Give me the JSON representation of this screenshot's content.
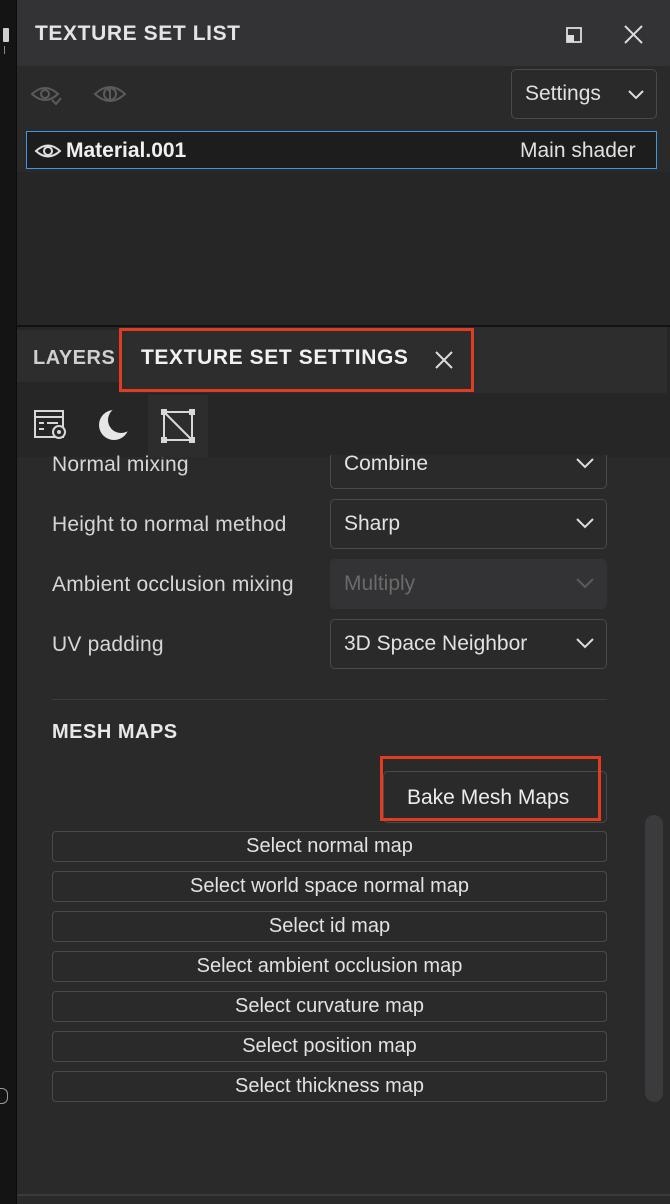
{
  "header": {
    "title": "TEXTURE SET LIST"
  },
  "toolbar": {
    "settings_label": "Settings"
  },
  "texture_set": {
    "name": "Material.001",
    "shader": "Main shader"
  },
  "tabs": {
    "layers": "LAYERS",
    "texture_set_settings": "TEXTURE SET SETTINGS"
  },
  "settings": [
    {
      "label": "Normal mixing",
      "value": "Combine"
    },
    {
      "label": "Height to normal method",
      "value": "Sharp"
    },
    {
      "label": "Ambient occlusion mixing",
      "value": "Multiply",
      "disabled": true
    },
    {
      "label": "UV padding",
      "value": "3D Space Neighbor"
    }
  ],
  "mesh_maps": {
    "title": "MESH MAPS",
    "bake_label": "Bake Mesh Maps",
    "buttons": [
      "Select normal map",
      "Select world space normal map",
      "Select id map",
      "Select ambient occlusion map",
      "Select curvature map",
      "Select position map",
      "Select thickness map"
    ]
  },
  "colors": {
    "highlight": "#e13b22",
    "selection": "#3f95e6",
    "panel": "#2a2a2b"
  }
}
